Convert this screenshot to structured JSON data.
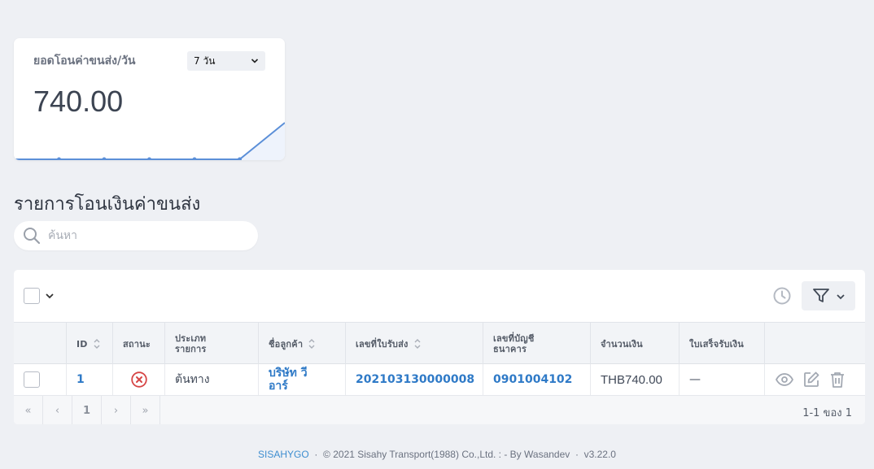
{
  "metric": {
    "title": "ยอดโอนค่าขนส่ง/วัน",
    "range_selected": "7 วัน",
    "value": "740.00",
    "sparkline": [
      0,
      0,
      0,
      0,
      0,
      0,
      740
    ],
    "color": "#5b8fd8"
  },
  "page": {
    "heading": "รายการโอนเงินค่าขนส่ง",
    "search_placeholder": "ค้นหา"
  },
  "table": {
    "columns": [
      "ID",
      "สถานะ",
      "ประเภท\nรายการ",
      "ชื่อลูกค้า",
      "เลขที่ใบรับส่ง",
      "เลขที่บัญชี\nธนาคาร",
      "จำนวนเงิน",
      "ใบเสร็จรับเงิน"
    ],
    "rows": [
      {
        "id": "1",
        "status": "x-circle-icon",
        "type": "ต้นทาง",
        "customer": "บริษัท วี\nอาร์",
        "waybill": "202103130000008",
        "account": "0901004102",
        "amount": "THB740.00",
        "receipt": "—"
      }
    ],
    "pager": {
      "first": "«",
      "prev": "‹",
      "current": "1",
      "next": "›",
      "last": "»",
      "info": "1-1 ของ 1"
    },
    "status_color": "#d64545",
    "link_color": "#2f7ac7"
  },
  "footer": {
    "brand": "SISAHYGO",
    "sep1": "·",
    "copyright": "© 2021 Sisahy Transport(1988) Co.,Ltd. : - By Wasandev",
    "sep2": "·",
    "version": "v3.22.0"
  }
}
